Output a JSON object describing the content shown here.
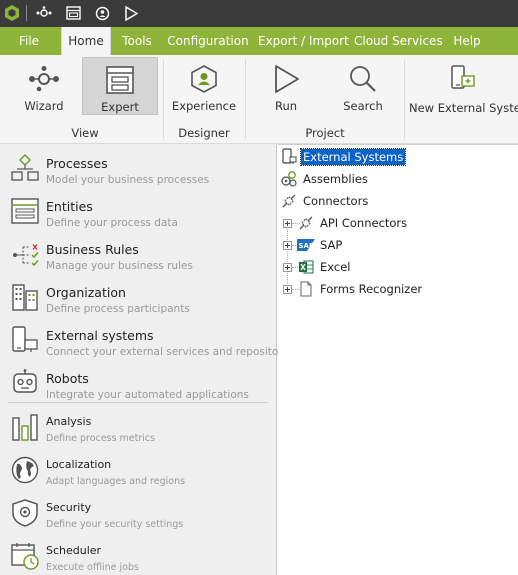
{
  "colors": {
    "title_bar": "#3b3b3b",
    "menu_bar": "#8fb43a",
    "ribbon": "#f5f5f5",
    "selection": "#0b62c9",
    "accent_green": "#6d9a1e"
  },
  "menu": [
    "File",
    "Home",
    "Tools",
    "Configuration",
    "Export / Import",
    "Cloud Services",
    "Help"
  ],
  "ribbon": {
    "buttons": {
      "wizard": "Wizard",
      "expert": "Expert",
      "experience": "Experience",
      "run": "Run",
      "search": "Search",
      "new_external": "New External System"
    },
    "groups": {
      "view": "View",
      "designer": "Designer",
      "project": "Project"
    }
  },
  "nav": [
    {
      "title": "Processes",
      "subtitle": "Model your business processes"
    },
    {
      "title": "Entities",
      "subtitle": "Define your process data"
    },
    {
      "title": "Business Rules",
      "subtitle": "Manage your business rules"
    },
    {
      "title": "Organization",
      "subtitle": "Define process participants"
    },
    {
      "title": "External systems",
      "subtitle": "Connect your external services and repositories"
    },
    {
      "title": "Robots",
      "subtitle": "Integrate your automated applications"
    },
    {
      "title": "Analysis",
      "subtitle": "Define process metrics"
    },
    {
      "title": "Localization",
      "subtitle": "Adapt languages and regions"
    },
    {
      "title": "Security",
      "subtitle": "Define your security settings"
    },
    {
      "title": "Scheduler",
      "subtitle": "Execute offline jobs"
    }
  ],
  "tree": {
    "external_systems": "External Systems",
    "assemblies": "Assemblies",
    "connectors": "Connectors",
    "children": [
      "API Connectors",
      "SAP",
      "Excel",
      "Forms Recognizer"
    ]
  }
}
